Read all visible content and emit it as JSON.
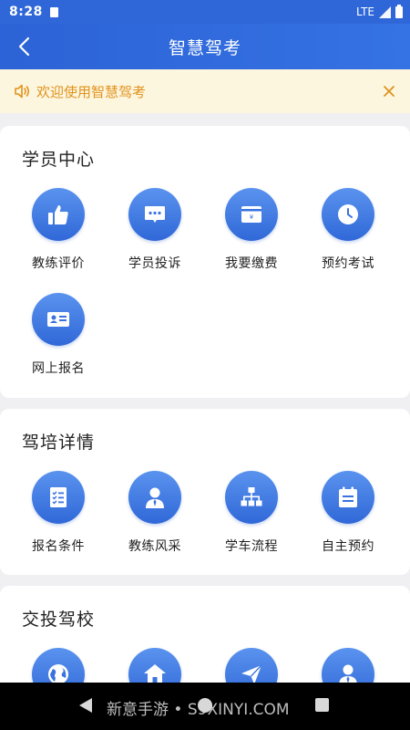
{
  "status_bar": {
    "time": "8:28",
    "network": "LTE"
  },
  "app_bar": {
    "title": "智慧驾考"
  },
  "notice": {
    "text": "欢迎使用智慧驾考"
  },
  "sections": [
    {
      "title": "学员中心",
      "items": [
        {
          "label": "教练评价",
          "icon": "thumbs-up-icon"
        },
        {
          "label": "学员投诉",
          "icon": "chat-bubble-icon"
        },
        {
          "label": "我要缴费",
          "icon": "payment-card-icon"
        },
        {
          "label": "预约考试",
          "icon": "clock-icon"
        },
        {
          "label": "网上报名",
          "icon": "id-card-icon"
        }
      ]
    },
    {
      "title": "驾培详情",
      "items": [
        {
          "label": "报名条件",
          "icon": "checklist-icon"
        },
        {
          "label": "教练风采",
          "icon": "person-icon"
        },
        {
          "label": "学车流程",
          "icon": "flowchart-icon"
        },
        {
          "label": "自主预约",
          "icon": "notepad-icon"
        }
      ]
    },
    {
      "title": "交投驾校",
      "items": [
        {
          "label": "",
          "icon": "globe-icon"
        },
        {
          "label": "",
          "icon": "home-icon"
        },
        {
          "label": "",
          "icon": "paper-plane-icon"
        },
        {
          "label": "",
          "icon": "user-tie-icon"
        }
      ]
    }
  ],
  "nav_bar": {
    "watermark": "新意手游 • S9XINYI.COM"
  },
  "colors": {
    "primary": "#2f67d9",
    "notice_bg": "#fdf6df",
    "notice_text": "#e0921b"
  }
}
